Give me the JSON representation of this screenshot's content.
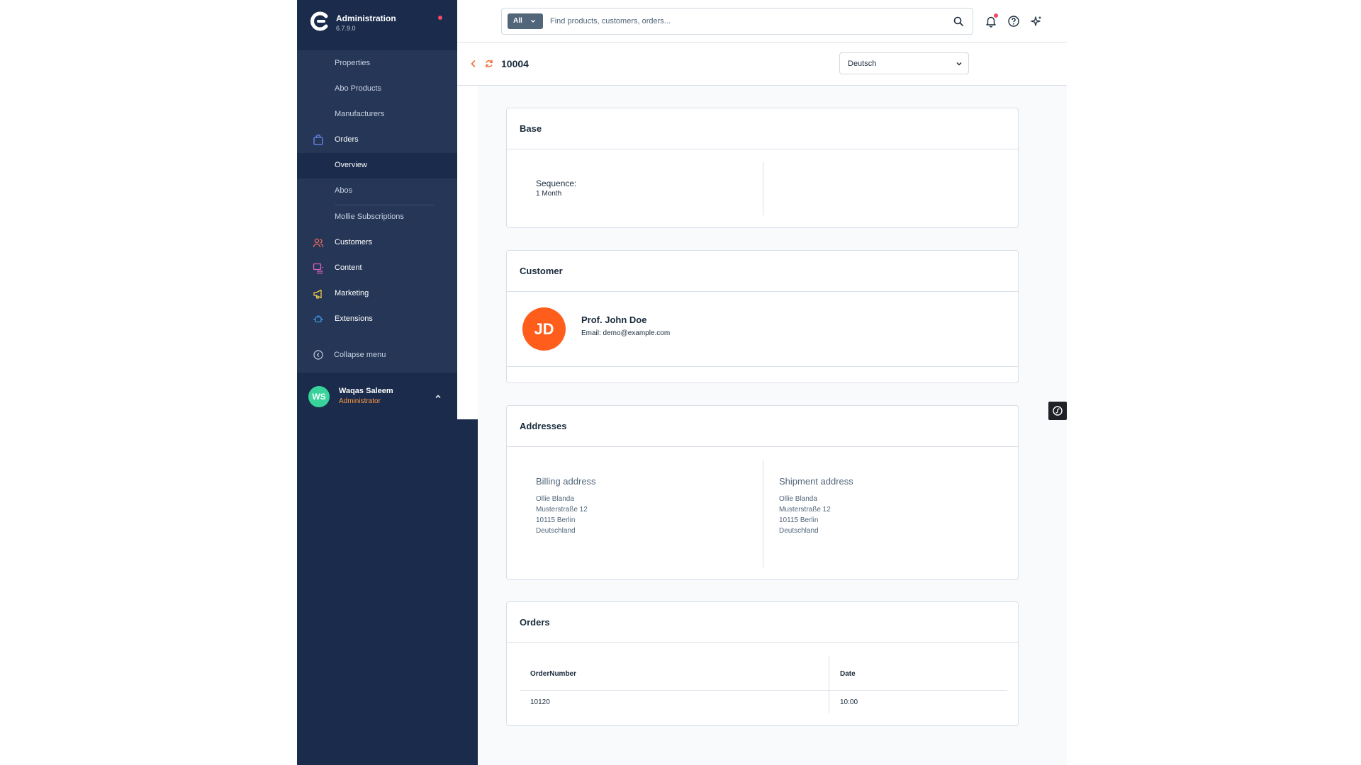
{
  "brand": {
    "title": "Administration",
    "version": "6.7.9.0"
  },
  "sidebar": {
    "items": [
      {
        "label": "Properties"
      },
      {
        "label": "Abo Products"
      },
      {
        "label": "Manufacturers"
      },
      {
        "label": "Orders",
        "icon": "shopping-bag-icon"
      },
      {
        "label": "Overview"
      },
      {
        "label": "Abos"
      },
      {
        "label": "Mollie Subscriptions"
      },
      {
        "label": "Customers",
        "icon": "users-icon"
      },
      {
        "label": "Content",
        "icon": "content-icon"
      },
      {
        "label": "Marketing",
        "icon": "megaphone-icon"
      },
      {
        "label": "Extensions",
        "icon": "plug-icon"
      }
    ],
    "collapse_label": "Collapse menu",
    "accent_colors": {
      "orders": "#6b8af5",
      "customers": "#f26b5b",
      "content": "#e05fc6",
      "marketing": "#f2c94c",
      "extensions": "#3c9ae8"
    }
  },
  "user": {
    "initials": "WS",
    "name": "Waqas Saleem",
    "role": "Administrator"
  },
  "search": {
    "scope": "All",
    "placeholder": "Find products, customers, orders..."
  },
  "page": {
    "title": "10004",
    "language": "Deutsch"
  },
  "base": {
    "title": "Base",
    "sequence_label": "Sequence:",
    "sequence_value": "1 Month"
  },
  "customer": {
    "title": "Customer",
    "initials": "JD",
    "name": "Prof. John Doe",
    "email": "Email: demo@example.com",
    "avatar_color": "#fe5d1b"
  },
  "addresses": {
    "title": "Addresses",
    "billing": {
      "title": "Billing address",
      "lines": [
        "Ollie Blanda",
        "Musterstraße 12",
        "10115 Berlin",
        "Deutschland"
      ]
    },
    "shipping": {
      "title": "Shipment address",
      "lines": [
        "Ollie Blanda",
        "Musterstraße 12",
        "10115 Berlin",
        "Deutschland"
      ]
    }
  },
  "orders": {
    "title": "Orders",
    "columns": [
      "OrderNumber",
      "Date"
    ],
    "rows": [
      [
        "10120",
        "10:00"
      ]
    ]
  }
}
